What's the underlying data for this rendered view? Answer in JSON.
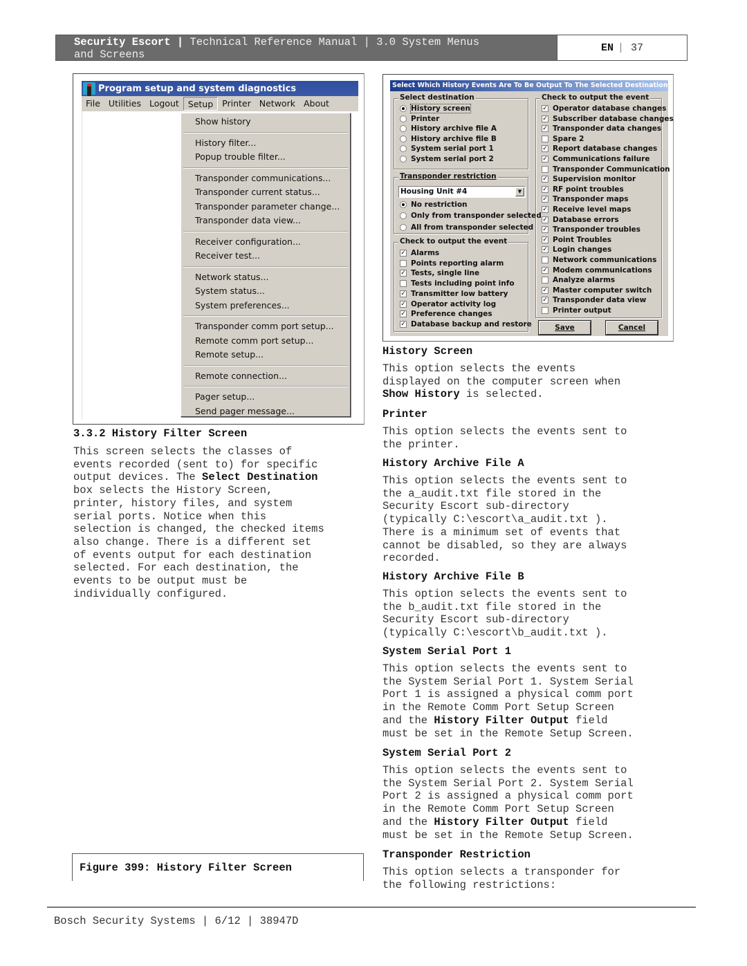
{
  "header": {
    "product": "Security Escort",
    "sep1": " | ",
    "rest": "Technical Reference Manual | 3.0  System Menus",
    "line2": "and Screens",
    "lang": "EN",
    "sep2": "|",
    "page": "37"
  },
  "setup_window": {
    "title": "Program setup and system diagnostics",
    "menu": [
      "File",
      "Utilities",
      "Logout",
      "Setup",
      "Printer",
      "Network",
      "About"
    ],
    "active_menu": "Setup",
    "dropdown_groups": [
      [
        "Show history"
      ],
      [
        "History filter...",
        "Popup trouble filter..."
      ],
      [
        "Transponder communications...",
        "Transponder current status...",
        "Transponder parameter change...",
        "Transponder data view..."
      ],
      [
        "Receiver configuration...",
        "Receiver test..."
      ],
      [
        "Network status...",
        "System status...",
        "System preferences..."
      ],
      [
        "Transponder comm port setup...",
        "Remote comm port setup...",
        "Remote setup..."
      ],
      [
        "Remote connection..."
      ],
      [
        "Pager setup...",
        "Send pager message..."
      ]
    ]
  },
  "section": {
    "heading": "3.3.2 History Filter Screen",
    "lines": [
      "This screen selects the classes of",
      "events recorded (sent to) for specific",
      "output devices. The ",
      "box selects the History Screen,",
      "printer, history files, and system",
      "serial ports. Notice when this",
      "selection is changed, the checked items",
      "also change. There is a different set",
      "of events output for each destination",
      "selected. For each destination, the",
      "events to be output must be",
      "individually configured."
    ],
    "bold_term": "Select Destination"
  },
  "figure_caption": "Figure 399: History Filter Screen",
  "dialog": {
    "title": "Select Which History Events Are To Be Output To The Selected Destination",
    "destination_label": "Select destination",
    "destinations": [
      {
        "label": "History screen",
        "selected": true
      },
      {
        "label": "Printer",
        "selected": false
      },
      {
        "label": "History archive file A",
        "selected": false
      },
      {
        "label": "History archive file B",
        "selected": false
      },
      {
        "label": "System serial port 1",
        "selected": false
      },
      {
        "label": "System serial port 2",
        "selected": false
      }
    ],
    "restriction_label": "Transponder restriction",
    "restriction_value": "Housing Unit #4",
    "restrictions": [
      {
        "label": "No restriction",
        "selected": true
      },
      {
        "label": "Only from transponder selected",
        "selected": false
      },
      {
        "label": "All from transponder selected",
        "selected": false
      }
    ],
    "left_events_label": "Check to output the event",
    "left_events": [
      {
        "label": "Alarms",
        "checked": true
      },
      {
        "label": "Points reporting alarm",
        "checked": false
      },
      {
        "label": "Tests, single line",
        "checked": true
      },
      {
        "label": "Tests including point info",
        "checked": false
      },
      {
        "label": "Transmitter low battery",
        "checked": true
      },
      {
        "label": "Operator activity log",
        "checked": true
      },
      {
        "label": "Preference changes",
        "checked": true
      },
      {
        "label": "Database backup and restore",
        "checked": true
      }
    ],
    "right_events_label": "Check to output the event",
    "right_events": [
      {
        "label": "Operator database changes",
        "checked": true
      },
      {
        "label": "Subscriber database changes",
        "checked": true
      },
      {
        "label": "Transponder data changes",
        "checked": true
      },
      {
        "label": "Spare 2",
        "checked": false
      },
      {
        "label": "Report database changes",
        "checked": true
      },
      {
        "label": "Communications failure",
        "checked": true
      },
      {
        "label": "Transponder Communication",
        "checked": false
      },
      {
        "label": "Supervision monitor",
        "checked": true
      },
      {
        "label": "RF point troubles",
        "checked": true
      },
      {
        "label": "Transponder maps",
        "checked": true
      },
      {
        "label": "Receive level maps",
        "checked": true
      },
      {
        "label": "Database errors",
        "checked": true
      },
      {
        "label": "Transponder troubles",
        "checked": true
      },
      {
        "label": "Point Troubles",
        "checked": true
      },
      {
        "label": "Login changes",
        "checked": true
      },
      {
        "label": "Network communications",
        "checked": false
      },
      {
        "label": "Modem communications",
        "checked": true
      },
      {
        "label": "Analyze alarms",
        "checked": false
      },
      {
        "label": "Master computer switch",
        "checked": true
      },
      {
        "label": "Transponder data view",
        "checked": true
      },
      {
        "label": "Printer output",
        "checked": false
      }
    ],
    "save_label": "Save",
    "cancel_label": "Cancel"
  },
  "right_column": [
    {
      "heading": "History Screen",
      "lines": [
        "This option selects the events",
        "displayed on the computer screen when",
        "|B|Show History| is selected."
      ]
    },
    {
      "heading": "Printer",
      "lines": [
        "This option selects the events sent to",
        "the printer."
      ]
    },
    {
      "heading": "History Archive File A",
      "lines": [
        "This option selects the events sent to",
        "the a_audit.txt file stored in the",
        "Security Escort sub-directory",
        "(typically C:\\escort\\a_audit.txt ).",
        "There is a minimum set of events that",
        "cannot be disabled, so they are always",
        "recorded."
      ]
    },
    {
      "heading": "History Archive File B",
      "lines": [
        "This option selects the events sent to",
        "the b_audit.txt file stored in the",
        "Security Escort sub-directory",
        "(typically C:\\escort\\b_audit.txt )."
      ]
    },
    {
      "heading": "System Serial Port 1",
      "lines": [
        "This option selects the events sent to",
        "the System Serial Port 1. System Serial",
        "Port 1 is assigned a physical comm port",
        "in the Remote Comm Port Setup Screen",
        "and the |B|History Filter Output| field",
        "must be set in the Remote Setup Screen."
      ]
    },
    {
      "heading": "System Serial Port 2",
      "lines": [
        "This option selects the events sent to",
        "the System Serial Port 2. System Serial",
        "Port 2 is assigned a physical comm port",
        "in the Remote Comm Port Setup Screen",
        "and the |B|History Filter Output| field",
        "must be set in the Remote Setup Screen."
      ]
    },
    {
      "heading": "Transponder Restriction",
      "lines": [
        "This option selects a transponder for",
        "the following restrictions:"
      ]
    }
  ],
  "footer": "Bosch Security Systems | 6/12 | 38947D"
}
